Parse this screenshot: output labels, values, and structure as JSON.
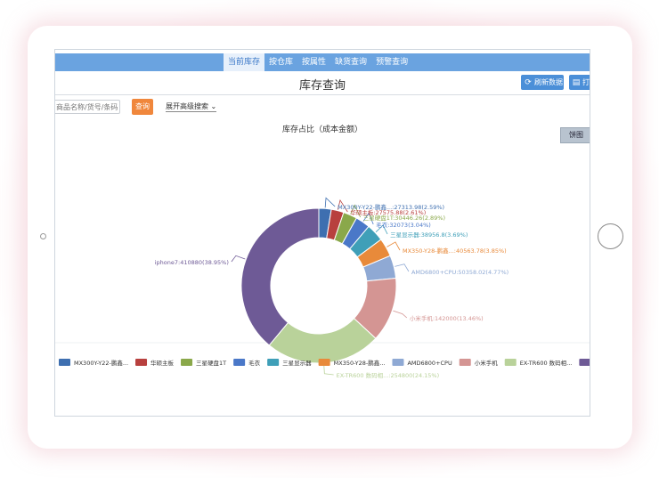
{
  "nav": {
    "tabs": [
      {
        "label": "当前库存",
        "active": true
      },
      {
        "label": "按仓库",
        "active": false
      },
      {
        "label": "按属性",
        "active": false
      },
      {
        "label": "缺货查询",
        "active": false
      },
      {
        "label": "预警查询",
        "active": false
      }
    ]
  },
  "header": {
    "title": "库存查询",
    "refresh_label": "刷新数据",
    "print_label": "打印"
  },
  "search": {
    "placeholder": "商品名称/货号/条码/",
    "query_label": "查询",
    "advanced_label": "展开高级搜索"
  },
  "chart_toggle_label": "饼图",
  "colors": {
    "nav": "#6aa3e0",
    "query_button": "#f0873c",
    "action_button": "#4b8fd8"
  },
  "chart_data": {
    "type": "pie",
    "title": "库存占比（成本金额）",
    "donut": true,
    "legend_position": "bottom",
    "slices": [
      {
        "name": "MX300Y-Y22-鹏鑫...",
        "value": 27313.98,
        "percent": "2.59%",
        "color": "#3e6fb0",
        "label": "MX300Y-Y22-鹏鑫...:27313.98(2.59%)"
      },
      {
        "name": "华硕主板",
        "value": 27575.88,
        "percent": "2.61%",
        "color": "#b8403e",
        "label": "华硕主板:27575.88(2.61%)"
      },
      {
        "name": "三星硬盘1T",
        "value": 30446.26,
        "percent": "2.89%",
        "color": "#8aa84a",
        "label": "三星硬盘1T:30446.26(2.89%)"
      },
      {
        "name": "毛衣",
        "value": 32073,
        "percent": "3.04%",
        "color": "#4a78c8",
        "label": "毛衣:32073(3.04%)"
      },
      {
        "name": "三星显示器",
        "value": 38956.8,
        "percent": "3.69%",
        "color": "#3f9fb8",
        "label": "三星显示器:38956.8(3.69%)"
      },
      {
        "name": "MX350-Y28-鹏鑫...",
        "value": 40563.78,
        "percent": "3.85%",
        "color": "#e88a3a",
        "label": "MX350-Y28-鹏鑫...:40563.78(3.85%)"
      },
      {
        "name": "AMD6800+CPU",
        "value": 50358.02,
        "percent": "4.77%",
        "color": "#8fa9d4",
        "label": "AMD6800+CPU:50358.02(4.77%)"
      },
      {
        "name": "小米手机",
        "value": 142000,
        "percent": "13.46%",
        "color": "#d49593",
        "label": "小米手机:142000(13.46%)"
      },
      {
        "name": "EX-TR600 数码相...",
        "value": 254800,
        "percent": "24.15%",
        "color": "#b9d29a",
        "label": "EX-TR600 数码相...:254800(24.15%)"
      },
      {
        "name": "iphone7",
        "value": 410880,
        "percent": "38.95%",
        "color": "#6e5a96",
        "label": "iphone7:410880(38.95%)"
      }
    ]
  }
}
